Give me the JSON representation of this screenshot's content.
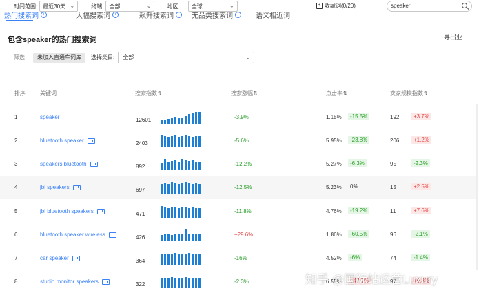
{
  "filters": {
    "time_label": "时间范围:",
    "time_value": "最近30天",
    "device_label": "终端:",
    "device_value": "全部",
    "region_label": "地区:",
    "region_value": "全球",
    "favorites": "收藏词(0/20)",
    "search_value": "speaker"
  },
  "tabs": [
    "热门搜索词",
    "大幅搜索词",
    "飙升搜索词",
    "无品类搜索词",
    "语义相近词"
  ],
  "title": "包含speaker的热门搜索词",
  "export_label": "导出业",
  "subfilter": {
    "screen_label": "筛选",
    "chip_label": "未加入直通车词库",
    "category_label": "选择类目:",
    "category_value": "全部"
  },
  "columns": [
    "排序",
    "关键词",
    "搜索指数",
    "搜索涨幅",
    "点击率",
    "卖家规模指数"
  ],
  "rows": [
    {
      "rank": "1",
      "keyword": "speaker",
      "index": "12601",
      "trend": "-3.9%",
      "ctr": "1.15%",
      "ctr_change": "-15.5%",
      "sellers": "192",
      "seller_change": "+3.7%",
      "bars": [
        0.25,
        0.3,
        0.35,
        0.4,
        0.5,
        0.45,
        0.4,
        0.55,
        0.7,
        0.8,
        0.85,
        0.85
      ]
    },
    {
      "rank": "2",
      "keyword": "bluetooth speaker",
      "index": "2403",
      "trend": "-5.6%",
      "ctr": "5.95%",
      "ctr_change": "-23.8%",
      "sellers": "206",
      "seller_change": "+1.2%",
      "bars": [
        0.85,
        0.8,
        0.75,
        0.8,
        0.85,
        0.75,
        0.8,
        0.85,
        0.8,
        0.75,
        0.8,
        0.8
      ]
    },
    {
      "rank": "3",
      "keyword": "speakers bluetooth",
      "index": "892",
      "trend": "-12.2%",
      "ctr": "5.27%",
      "ctr_change": "-6.3%",
      "sellers": "95",
      "seller_change": "-2.3%",
      "bars": [
        0.55,
        0.8,
        0.6,
        0.7,
        0.75,
        0.6,
        0.8,
        0.75,
        0.7,
        0.75,
        0.65,
        0.6
      ]
    },
    {
      "rank": "4",
      "keyword": "jbl speakers",
      "index": "697",
      "trend": "-12.5%",
      "ctr": "5.23%",
      "ctr_change": "0%",
      "sellers": "15",
      "seller_change": "+2.5%",
      "bars": [
        0.75,
        0.8,
        0.75,
        0.85,
        0.8,
        0.75,
        0.8,
        0.85,
        0.8,
        0.75,
        0.8,
        0.75
      ]
    },
    {
      "rank": "5",
      "keyword": "jbl bluetooth speakers",
      "index": "471",
      "trend": "-11.8%",
      "ctr": "4.76%",
      "ctr_change": "-19.2%",
      "sellers": "11",
      "seller_change": "+7.6%",
      "bars": [
        0.85,
        0.8,
        0.75,
        0.8,
        0.8,
        0.75,
        0.8,
        0.8,
        0.75,
        0.8,
        0.75,
        0.7
      ]
    },
    {
      "rank": "6",
      "keyword": "bluetooth speaker wireless",
      "index": "426",
      "trend": "+29.6%",
      "ctr": "1.86%",
      "ctr_change": "-60.5%",
      "sellers": "96",
      "seller_change": "-2.1%",
      "bars": [
        0.45,
        0.5,
        0.55,
        0.45,
        0.5,
        0.55,
        0.5,
        0.9,
        0.55,
        0.5,
        0.55,
        0.5
      ]
    },
    {
      "rank": "7",
      "keyword": "car speaker",
      "index": "364",
      "trend": "-16%",
      "ctr": "4.52%",
      "ctr_change": "-6%",
      "sellers": "74",
      "seller_change": "-1.4%",
      "bars": [
        0.75,
        0.8,
        0.75,
        0.8,
        0.85,
        0.8,
        0.75,
        0.8,
        0.85,
        0.8,
        0.75,
        0.8
      ]
    },
    {
      "rank": "8",
      "keyword": "studio monitor speakers",
      "index": "322",
      "trend": "-2.3%",
      "ctr": "6.55%",
      "ctr_change": "+47.7%",
      "sellers": "97",
      "seller_change": "+0.8%",
      "bars": [
        0.7,
        0.75,
        0.7,
        0.8,
        0.75,
        0.7,
        0.75,
        0.8,
        0.75,
        0.7,
        0.75,
        0.7
      ]
    }
  ],
  "colors": {
    "accent": "#3b82f6",
    "bar": "#1f7fd4",
    "positive": "#e04848",
    "negative": "#2a9d2a"
  },
  "watermark": "知乎 @国际站运营Luxury"
}
